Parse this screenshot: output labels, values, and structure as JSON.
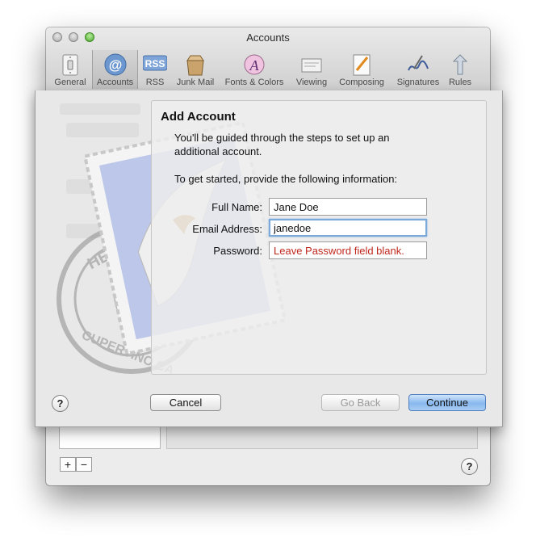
{
  "window": {
    "title": "Accounts"
  },
  "toolbar": {
    "items": [
      {
        "label": "General",
        "icon": "light-switch-icon"
      },
      {
        "label": "Accounts",
        "icon": "at-sign-icon",
        "selected": true
      },
      {
        "label": "RSS",
        "icon": "rss-icon"
      },
      {
        "label": "Junk Mail",
        "icon": "junk-mail-icon"
      },
      {
        "label": "Fonts & Colors",
        "icon": "fonts-colors-icon"
      },
      {
        "label": "Viewing",
        "icon": "viewing-icon"
      },
      {
        "label": "Composing",
        "icon": "composing-icon"
      },
      {
        "label": "Signatures",
        "icon": "signatures-icon"
      },
      {
        "label": "Rules",
        "icon": "rules-icon"
      }
    ]
  },
  "background": {
    "add_label": "+",
    "remove_label": "−",
    "help_label": "?"
  },
  "sheet": {
    "title": "Add Account",
    "intro": "You'll be guided through the steps to set up an additional account.",
    "prompt": "To get started, provide the following information:",
    "full_name_label": "Full Name:",
    "full_name_value": "Jane Doe",
    "email_label": "Email Address:",
    "email_value": "janedoe",
    "password_label": "Password:",
    "password_value": "Leave Password field blank.",
    "help_label": "?",
    "cancel_label": "Cancel",
    "back_label": "Go Back",
    "continue_label": "Continue",
    "stamp_text_top": "HELLO FR",
    "stamp_text_bottom": "CUPERTINO CA"
  },
  "colors": {
    "accent": "#7aa9da",
    "hint_red": "#c0281e",
    "default_button": "#88b8ee"
  }
}
